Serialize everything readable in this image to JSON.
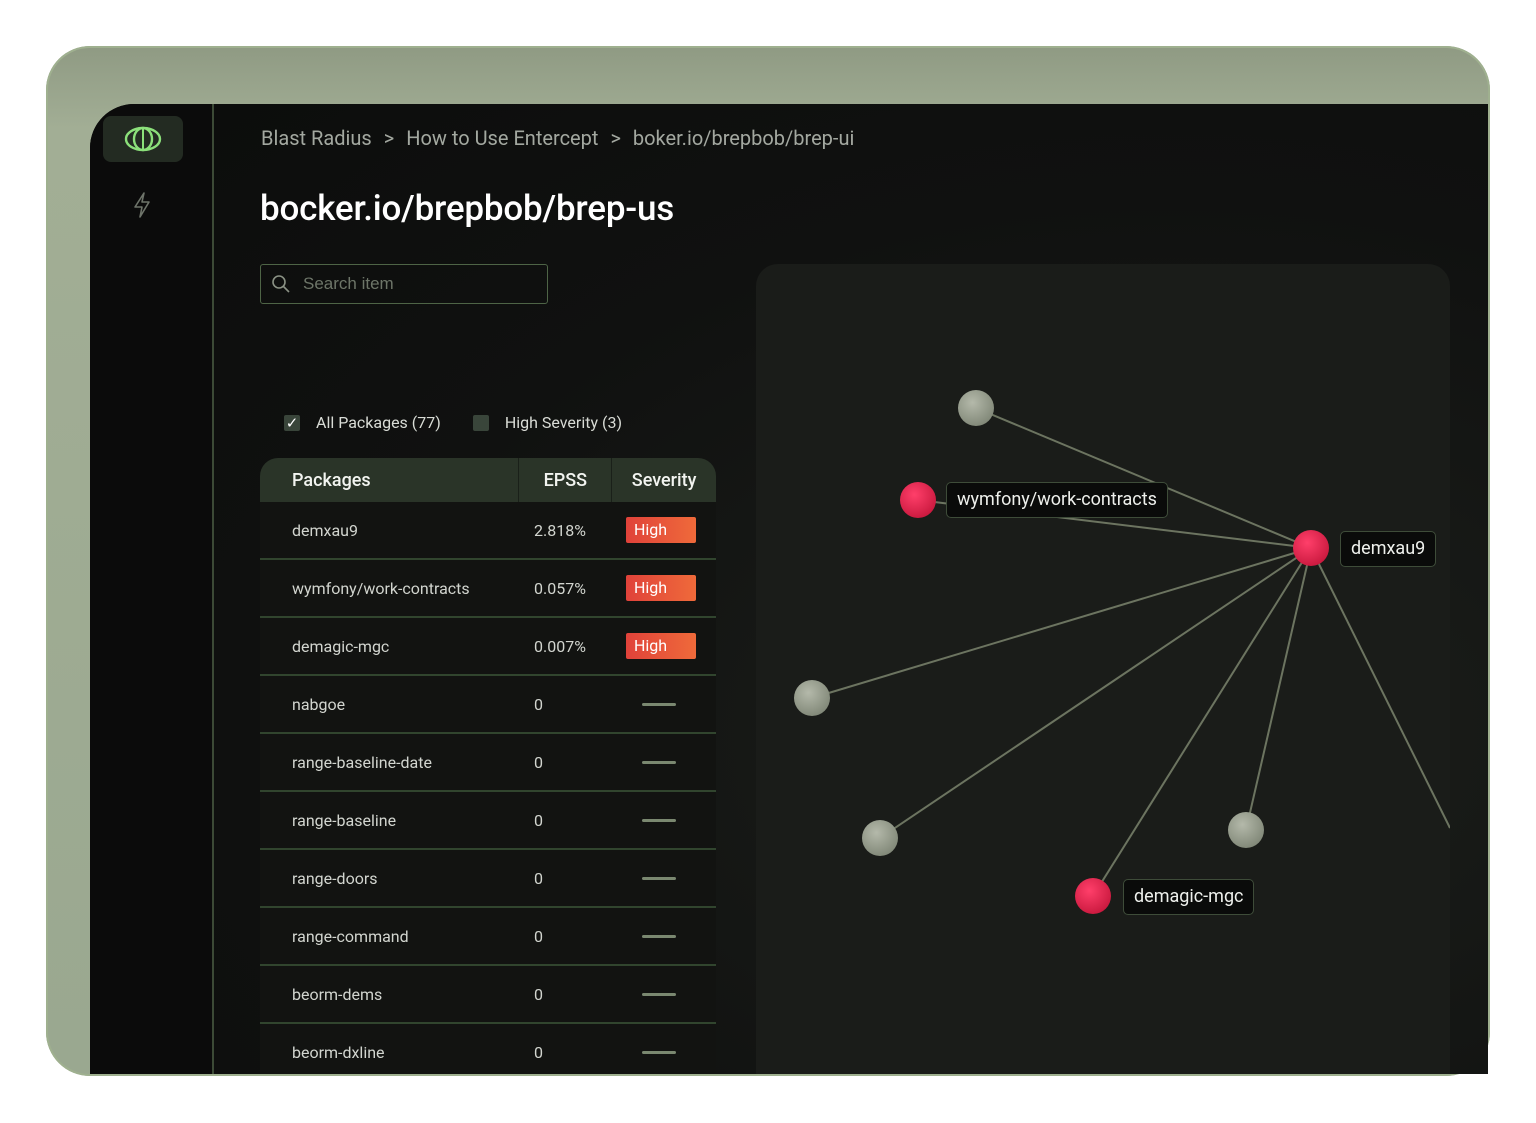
{
  "breadcrumb": [
    "Blast Radius",
    "How to Use Entercept",
    "boker.io/brepbob/brep-ui"
  ],
  "breadcrumb_separator": ">",
  "page_title": "bocker.io/brepbob/brep-us",
  "search": {
    "placeholder": "Search item",
    "value": ""
  },
  "filters": {
    "all": {
      "label": "All Packages (77)",
      "checked": true,
      "check_glyph": "✓"
    },
    "high": {
      "label": "High Severity (3)",
      "checked": false
    }
  },
  "table": {
    "headers": {
      "packages": "Packages",
      "epss": "EPSS",
      "severity": "Severity"
    },
    "rows": [
      {
        "package": "demxau9",
        "epss": "2.818%",
        "severity": "High"
      },
      {
        "package": "wymfony/work-contracts",
        "epss": "0.057%",
        "severity": "High"
      },
      {
        "package": "demagic-mgc",
        "epss": "0.007%",
        "severity": "High"
      },
      {
        "package": "nabgoe",
        "epss": "0",
        "severity": ""
      },
      {
        "package": "range-baseline-date",
        "epss": "0",
        "severity": ""
      },
      {
        "package": "range-baseline",
        "epss": "0",
        "severity": ""
      },
      {
        "package": "range-doors",
        "epss": "0",
        "severity": ""
      },
      {
        "package": "range-command",
        "epss": "0",
        "severity": ""
      },
      {
        "package": "beorm-dems",
        "epss": "0",
        "severity": ""
      },
      {
        "package": "beorm-dxline",
        "epss": "0",
        "severity": ""
      }
    ]
  },
  "graph": {
    "labels": {
      "demxau9": "demxau9",
      "wymfony": "wymfony/work-contracts",
      "demagic": "demagic-mgc"
    }
  },
  "colors": {
    "accent": "#4e6446",
    "high_node": "#e0234a",
    "neutral_node": "#9aa08f",
    "badge": "#e5503a"
  },
  "icons": {
    "logo": "eye-logo-icon",
    "nav": "bolt-icon",
    "search": "search-icon"
  }
}
